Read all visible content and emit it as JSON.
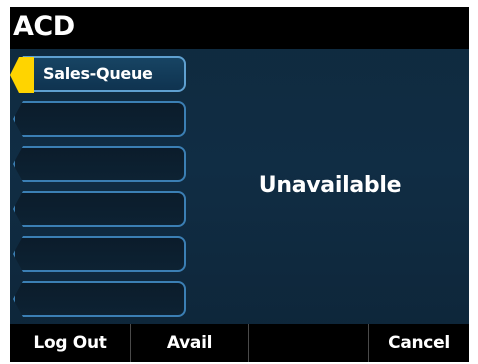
{
  "title": "ACD",
  "line_keys": [
    {
      "label": "Sales-Queue",
      "selected": true
    },
    {
      "label": "",
      "selected": false
    },
    {
      "label": "",
      "selected": false
    },
    {
      "label": "",
      "selected": false
    },
    {
      "label": "",
      "selected": false
    },
    {
      "label": "",
      "selected": false
    }
  ],
  "status": "Unavailable",
  "softkeys": [
    "Log Out",
    "Avail",
    "",
    "Cancel"
  ],
  "colors": {
    "background": "#102d44",
    "title_bar": "#000000",
    "key_border": "#3b7fb4",
    "selection_indicator": "#ffd400",
    "text": "#ffffff"
  },
  "icons": {
    "selection_indicator": "arrow-left-icon"
  }
}
